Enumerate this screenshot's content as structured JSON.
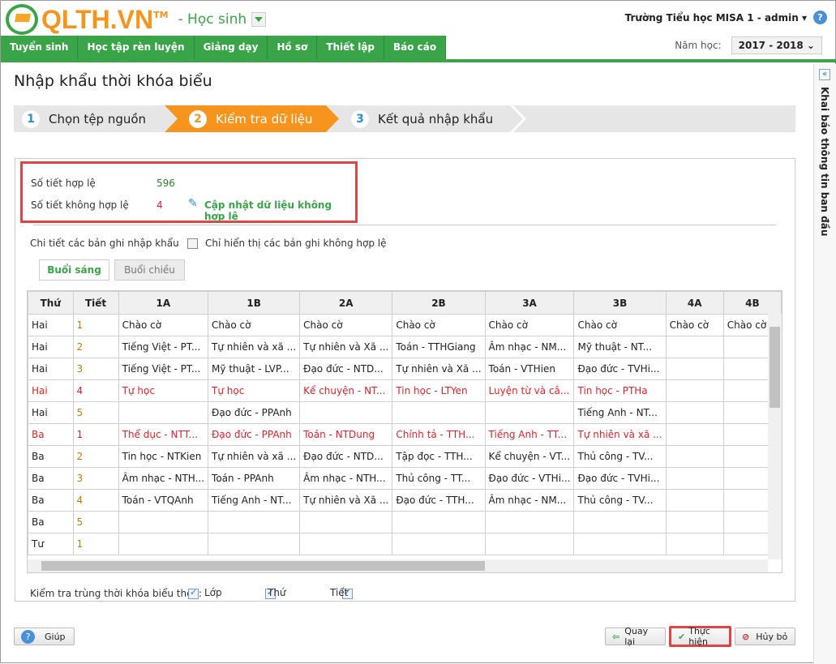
{
  "header": {
    "logo": "QLTH.VN",
    "tm": "TM",
    "role": "- Học sinh",
    "user": "Trường Tiểu học MISA 1 - admin ▾",
    "help": "?",
    "year_label": "Năm học:",
    "year": "2017 - 2018 ⌄"
  },
  "nav": [
    "Tuyển sinh",
    "Học tập rèn luyện",
    "Giảng dạy",
    "Hồ sơ",
    "Thiết lập",
    "Báo cáo"
  ],
  "page_title": "Nhập khẩu thời khóa biểu",
  "wizard": [
    {
      "n": "1",
      "label": "Chọn tệp nguồn"
    },
    {
      "n": "2",
      "label": "Kiểm tra dữ liệu"
    },
    {
      "n": "3",
      "label": "Kết quả nhập khẩu"
    }
  ],
  "summary": {
    "valid_label": "Số tiết hợp lệ",
    "valid": "596",
    "invalid_label": "Số tiết không hợp lệ",
    "invalid": "4",
    "update_link": "Cập nhật dữ liệu không hợp lệ"
  },
  "details_label": "Chi tiết các bản ghi nhập khẩu",
  "only_invalid_label": "Chỉ hiển thị các bản ghi không hợp lệ",
  "tabs": [
    "Buổi sáng",
    "Buổi chiều"
  ],
  "table": {
    "headers": [
      "Thứ",
      "Tiết",
      "1A",
      "1B",
      "2A",
      "2B",
      "3A",
      "3B",
      "4A",
      "4B"
    ],
    "rows": [
      {
        "err": false,
        "cells": [
          "Hai",
          "1",
          "Chào cờ",
          "Chào cờ",
          "Chào cờ",
          "Chào cờ",
          "Chào cờ",
          "Chào cờ",
          "Chào cờ",
          "Chào cờ"
        ]
      },
      {
        "err": false,
        "cells": [
          "Hai",
          "2",
          "Tiếng Việt - PT...",
          "Tự nhiên và xã ...",
          "Tự nhiên và Xã ...",
          "Toán - TTHGiang",
          "Âm nhạc - NM...",
          "Mỹ thuật - NT...",
          "",
          ""
        ]
      },
      {
        "err": false,
        "cells": [
          "Hai",
          "3",
          "Tiếng Việt - PT...",
          "Mỹ thuật - LVP...",
          "Đạo đức - NTD...",
          "Tự nhiên và Xã ...",
          "Toán - VTHien",
          "Đạo đức - TVHi...",
          "",
          ""
        ]
      },
      {
        "err": true,
        "cells": [
          "Hai",
          "4",
          "Tự học",
          "Tự học",
          "Kể chuyện - NT...",
          "Tin học - LTYen",
          "Luyện từ và câ...",
          "Tin học - PTHa",
          "",
          ""
        ]
      },
      {
        "err": false,
        "cells": [
          "Hai",
          "5",
          "",
          "Đạo đức - PPAnh",
          "",
          "",
          "",
          "Tiếng Anh - NT...",
          "",
          ""
        ]
      },
      {
        "err": true,
        "cells": [
          "Ba",
          "1",
          "Thể dục - NTT...",
          "Đạo đức - PPAnh",
          "Toán - NTDung",
          "Chính tả - TTH...",
          "Tiếng Anh - TT...",
          "Tự nhiên và xã ...",
          "",
          ""
        ]
      },
      {
        "err": false,
        "cells": [
          "Ba",
          "2",
          "Tin học - NTKien",
          "Tự nhiên và xã ...",
          "Đạo đức - NTD...",
          "Tập đọc - TTH...",
          "Kể chuyện - VT...",
          "Thủ công - TV...",
          "",
          ""
        ]
      },
      {
        "err": false,
        "cells": [
          "Ba",
          "3",
          "Âm nhạc - NTH...",
          "Toán - PPAnh",
          "Âm nhạc - NTH...",
          "Thủ công - TT...",
          "Đạo đức - VTHi...",
          "Đạo đức - TVHi...",
          "",
          ""
        ]
      },
      {
        "err": false,
        "cells": [
          "Ba",
          "4",
          "Toán - VTQAnh",
          "Tiếng Anh - NT...",
          "Tự nhiên và Xã ...",
          "Đạo đức - TTH...",
          "Âm nhạc - NM...",
          "Thủ công - TV...",
          "",
          ""
        ]
      },
      {
        "err": false,
        "cells": [
          "Ba",
          "5",
          "",
          "",
          "",
          "",
          "",
          "",
          "",
          ""
        ]
      },
      {
        "err": false,
        "cells": [
          "Tư",
          "1",
          "",
          "",
          "",
          "",
          "",
          "",
          "",
          ""
        ]
      }
    ]
  },
  "check": {
    "label": "Kiểm tra trùng thời khóa biểu theo:",
    "options": [
      "Lớp",
      "Thứ",
      "Tiết"
    ]
  },
  "buttons": {
    "help": "Giúp",
    "back": "Quay lại",
    "run": "Thực hiện",
    "cancel": "Hủy bỏ"
  },
  "sidebar": {
    "label": "Khai báo thông tin ban đầu",
    "collapse": "«"
  },
  "colors": {
    "green": "#3aa548",
    "orange": "#f7941d",
    "error": "#e8202a"
  }
}
